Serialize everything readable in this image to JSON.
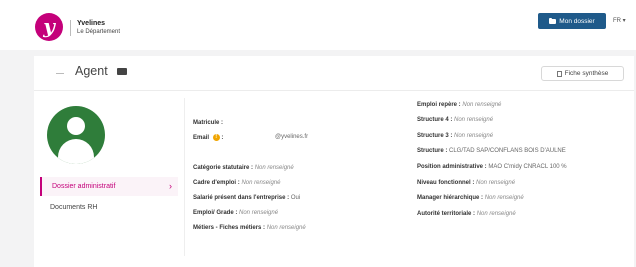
{
  "header": {
    "logo_letter": "y",
    "brand_name": "Yvelines",
    "brand_sub": "Le Département",
    "dossier_button": "Mon dossier",
    "lang": "FR ▾"
  },
  "page": {
    "title": "Agent",
    "fiche_button": "Fiche synthèse"
  },
  "sidebar": {
    "items": [
      {
        "label": "Dossier administratif"
      },
      {
        "label": "Documents RH"
      }
    ]
  },
  "left_fields": {
    "matricule": {
      "label": "Matricule :",
      "value": ""
    },
    "email": {
      "label": "Email",
      "sep": ":",
      "value": "@yvelines.fr"
    },
    "categorie": {
      "label": "Catégorie statutaire :",
      "value": "Non renseigné"
    },
    "cadre": {
      "label": "Cadre d'emploi :",
      "value": "Non renseigné"
    },
    "salarie": {
      "label": "Salarié présent dans l'entreprise :",
      "value": "Oui"
    },
    "emploi": {
      "label": "Emploi/ Grade :",
      "value": "Non renseigné"
    },
    "metiers": {
      "label": "Métiers - Fiches métiers :",
      "value": "Non renseigné"
    }
  },
  "right_fields": {
    "emploi_repere": {
      "label": "Emploi repère :",
      "value": "Non renseigné"
    },
    "structure4": {
      "label": "Structure 4 :",
      "value": "Non renseigné"
    },
    "structure3": {
      "label": "Structure 3 :",
      "value": "Non renseigné"
    },
    "structure": {
      "label": "Structure :",
      "value": "CLG/TAD SAP/CONFLANS BOIS D'AULNE"
    },
    "position": {
      "label": "Position administrative :",
      "value": "MAO C'midy CNRACL 100 %"
    },
    "niveau": {
      "label": "Niveau fonctionnel :",
      "value": "Non renseigné"
    },
    "manager": {
      "label": "Manager hiérarchique :",
      "value": "Non renseigné"
    },
    "autorite": {
      "label": "Autorité territoriale :",
      "value": "Non renseigné"
    }
  },
  "colors": {
    "accent": "#c4007a",
    "primary_button": "#1f5a8a",
    "avatar": "#2f7d3a",
    "warning": "#f0a500"
  },
  "icons": [
    "folder-icon",
    "mail-icon",
    "document-icon",
    "warning-icon",
    "chevron-right-icon",
    "user-avatar-icon"
  ]
}
